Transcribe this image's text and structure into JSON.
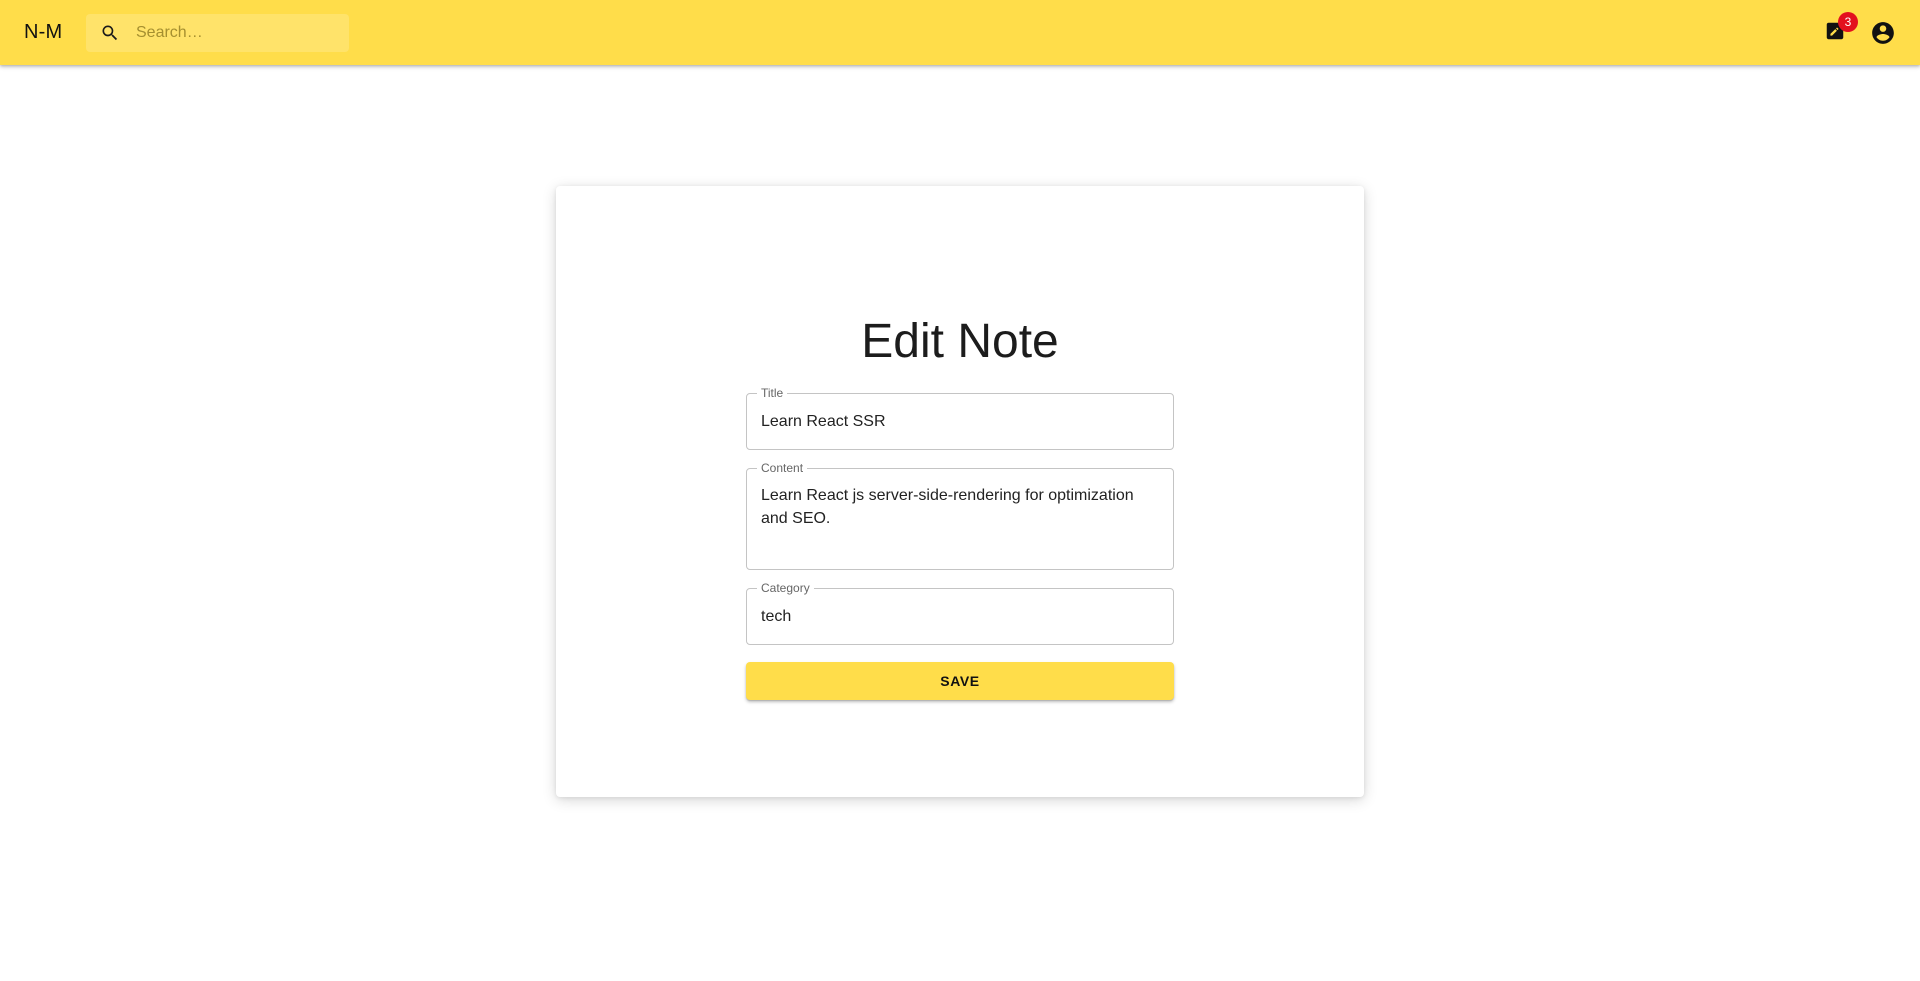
{
  "appbar": {
    "brand": "N-M",
    "search_placeholder": "Search…",
    "notes_badge": "3",
    "notes_icon": "note-edit-icon",
    "account_icon": "account-circle-icon",
    "search_icon": "search-icon",
    "background_color": "#ffdd4a"
  },
  "form": {
    "heading": "Edit Note",
    "title_label": "Title",
    "title_value": "Learn React SSR",
    "content_label": "Content",
    "content_value": "Learn React js server-side-rendering for optimization and SEO.",
    "category_label": "Category",
    "category_value": "tech",
    "save_label": "SAVE"
  },
  "colors": {
    "accent": "#ffdd4a",
    "badge": "#e3101e"
  }
}
